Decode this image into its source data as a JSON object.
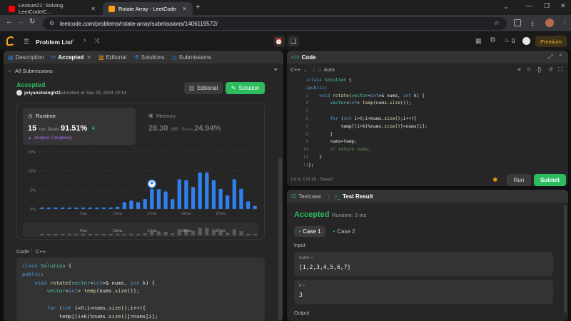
{
  "browser": {
    "tabs": [
      {
        "label": "Lecture21: Solving LeetCode/C...",
        "favicon_color": "#ff0000"
      },
      {
        "label": "Rotate Array - LeetCode",
        "favicon_color": "#ffa116"
      }
    ],
    "new_tab": "+",
    "url": "leetcode.com/problems/rotate-array/submissions/1406119572/"
  },
  "header": {
    "problem_list": "Problem List",
    "streak": "0",
    "premium": "Premium"
  },
  "left": {
    "tabs": [
      "Description",
      "Accepted",
      "Editorial",
      "Solutions",
      "Submissions"
    ],
    "all_submissions": "All Submissions",
    "status": "Accepted",
    "user": "priyanshsingh11",
    "submitted": "submitted at Sep 29, 2024 19:14",
    "editorial_btn": "Editorial",
    "solution_btn": "Solution",
    "runtime": {
      "title": "Runtime",
      "value": "15",
      "unit": "ms",
      "beats_label": "Beats",
      "beats": "91.51%",
      "analyze": "Analyze Complexity"
    },
    "memory": {
      "title": "Memory",
      "value": "28.30",
      "unit": "MB",
      "beats_label": "Beats",
      "beats": "24.94%"
    },
    "code_label": "Code",
    "code_lang": "C++"
  },
  "chart_data": {
    "type": "bar",
    "ylabel_ticks": [
      "15%",
      "10%",
      "5%",
      "0%"
    ],
    "ylim": [
      0,
      15
    ],
    "xticks": [
      "7ms",
      "12ms",
      "17ms",
      "22ms",
      "27ms"
    ],
    "values": [
      0.4,
      0.4,
      0.4,
      0.4,
      0.4,
      0.4,
      0.4,
      0.4,
      0.4,
      0.4,
      0.4,
      0.6,
      1.8,
      2.2,
      1.8,
      2.6,
      5.3,
      5.2,
      4.6,
      2.6,
      7.8,
      7.6,
      5.8,
      9.6,
      9.6,
      7.6,
      5.3,
      3.6,
      7.8,
      5.3,
      2.0,
      0.8
    ],
    "highlight_index": 16,
    "bar_color": "#2f80ed"
  },
  "right": {
    "code_tab": "Code",
    "lang": "C++",
    "mode": "Auto",
    "cursor": "Ln 9, Col 18",
    "saved": "Saved",
    "run": "Run",
    "submit": "Submit",
    "testcase_tab": "Testcase",
    "result_tab": "Test Result",
    "result_status": "Accepted",
    "result_runtime": "Runtime: 3 ms",
    "cases": [
      "Case 1",
      "Case 2"
    ],
    "input_label": "Input",
    "var1_name": "nums =",
    "var1_value": "[1,2,3,4,5,6,7]",
    "var2_name": "k =",
    "var2_value": "3",
    "output_label": "Output"
  },
  "editor_lines": [
    "1",
    "2",
    "3",
    "4",
    "5",
    "6",
    "7",
    "8",
    "9",
    "10",
    "11",
    "12"
  ]
}
